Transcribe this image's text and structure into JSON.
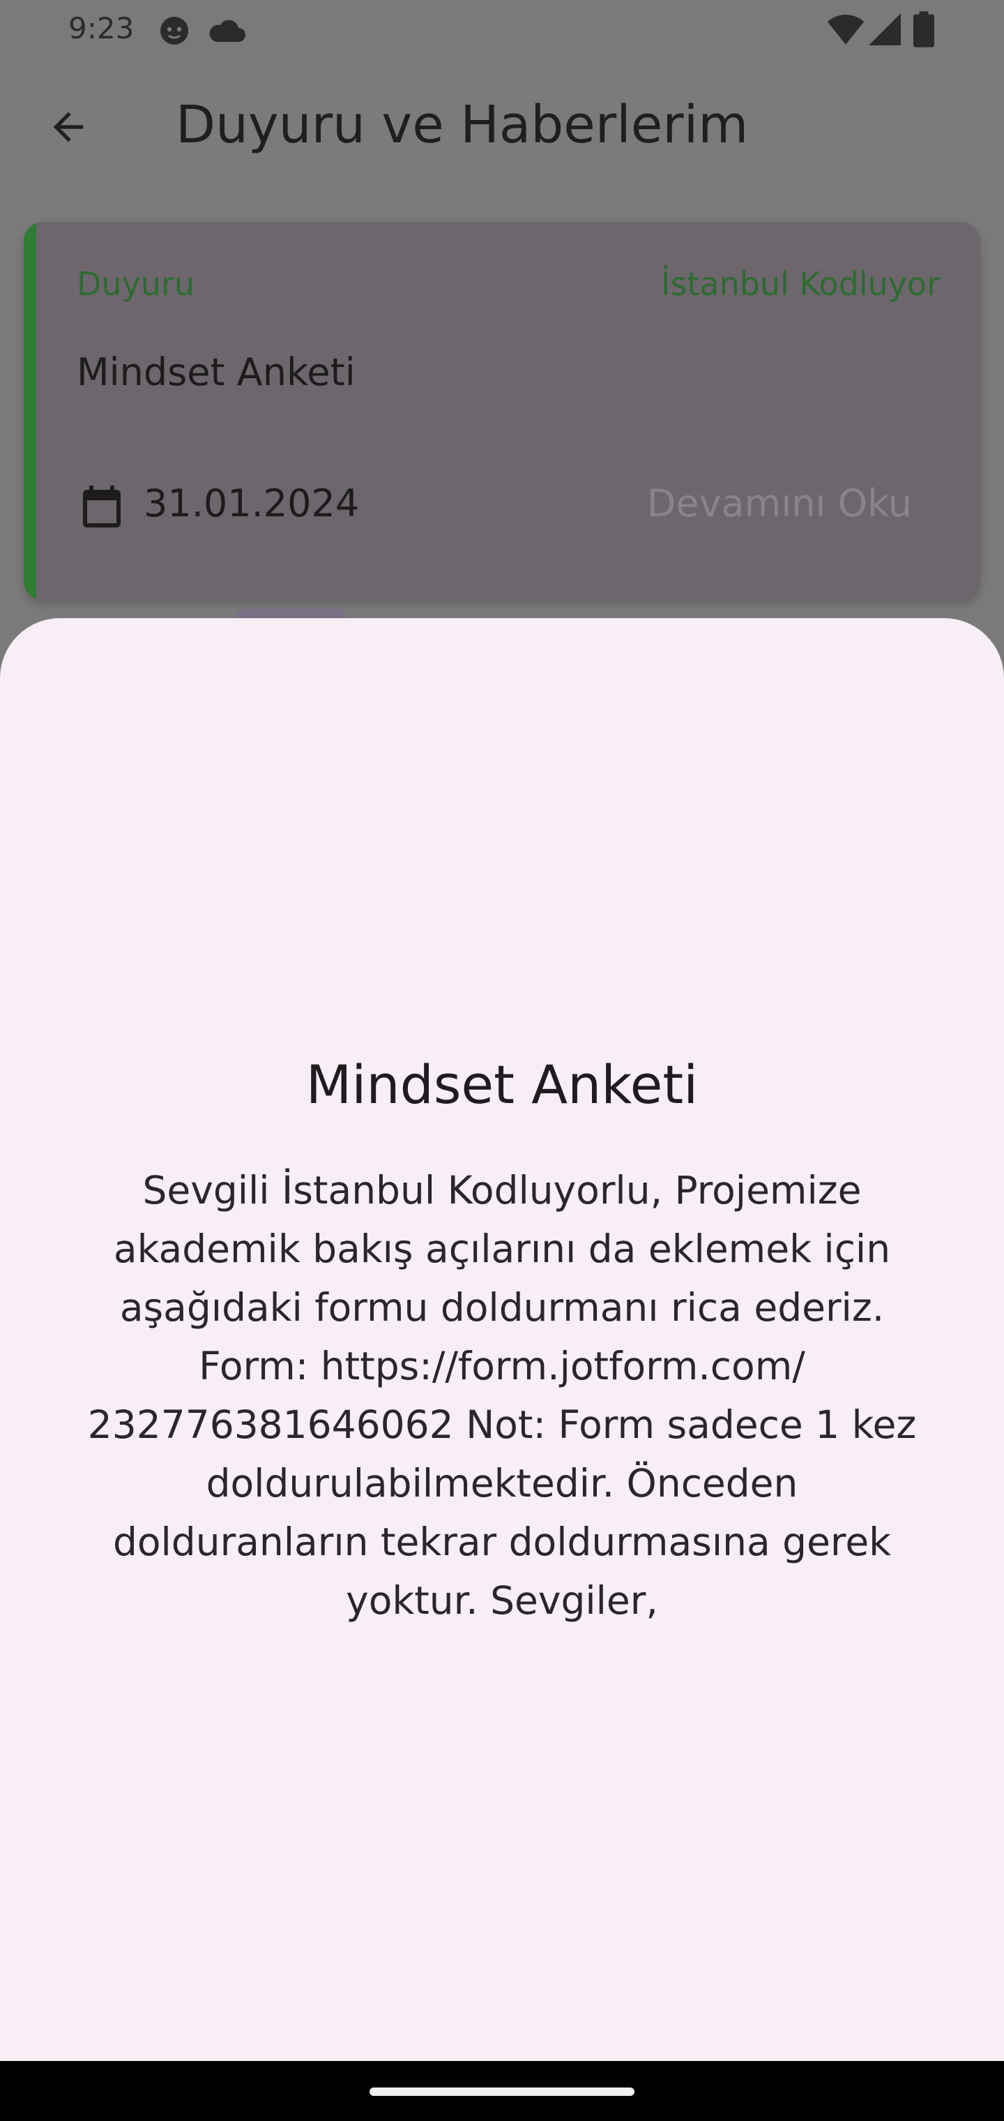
{
  "status_bar": {
    "time": "9:23",
    "icons": [
      "face-notification-icon",
      "cloud-icon",
      "wifi-icon",
      "signal-icon",
      "battery-icon"
    ]
  },
  "app_bar": {
    "back_icon": "arrow-back-icon",
    "title": "Duyuru ve Haberlerim"
  },
  "card": {
    "category": "Duyuru",
    "source": "İstanbul Kodluyor",
    "title": "Mindset Anketi",
    "date_icon": "calendar-icon",
    "date": "31.01.2024",
    "read_more": "Devamını Oku",
    "accent_color": "#2e7d32"
  },
  "sheet": {
    "title": "Mindset Anketi",
    "body": "Sevgili İstanbul Kodluyorlu, Projemize akademik bakış açılarını da eklemek için aşağıdaki formu doldurmanı rica ederiz. Form: https://form.jotform.com/ 232776381646062 Not: Form sadece 1 kez doldurulabilmektedir. Önceden dolduranların tekrar doldurmasına gerek yoktur. Sevgiler,"
  },
  "colors": {
    "scrim": "#7a7a7a",
    "sheet_background": "#f8eef6",
    "green_text": "#2e6b31"
  }
}
